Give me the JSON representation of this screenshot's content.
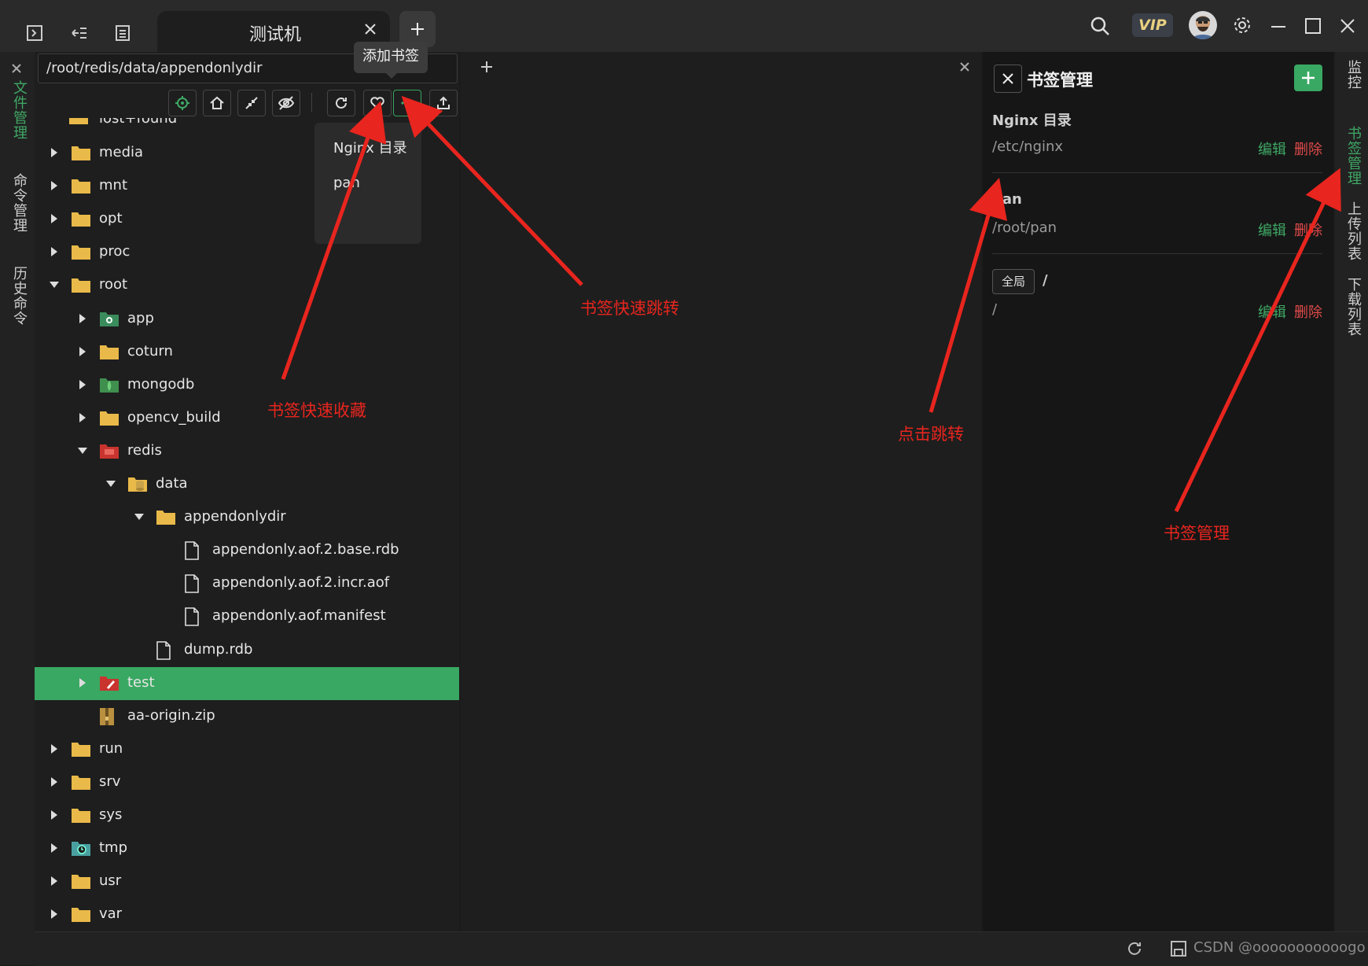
{
  "titlebar": {
    "tab_title": "测试机",
    "icons": [
      "terminal-icon",
      "tree-icon",
      "list-icon",
      "close-icon",
      "plus-icon",
      "search-icon",
      "avatar",
      "gear-icon",
      "minimize-icon",
      "maximize-icon",
      "window-close-icon"
    ],
    "vip_label": "VIP"
  },
  "left_strip": {
    "items": [
      {
        "label": "文件管理",
        "active": true
      },
      {
        "label": "命令管理",
        "active": false
      },
      {
        "label": "历史命令",
        "active": false
      }
    ]
  },
  "file_panel": {
    "path": "/root/redis/data/appendonlydir",
    "truncated_top_item": "lost+found",
    "toolbar_icons": [
      "locate-icon",
      "home-icon",
      "collapse-icon",
      "hide-icon",
      "refresh-icon",
      "heart-icon",
      "more-icon",
      "upload-icon"
    ],
    "tooltip": "添加书签",
    "dropdown": [
      "Nginx 目录",
      "pan"
    ],
    "tree": [
      {
        "name": "media",
        "kind": "folder",
        "expanded": false
      },
      {
        "name": "mnt",
        "kind": "folder",
        "expanded": false
      },
      {
        "name": "opt",
        "kind": "folder",
        "expanded": false
      },
      {
        "name": "proc",
        "kind": "folder",
        "expanded": false
      },
      {
        "name": "root",
        "kind": "folder",
        "expanded": true
      },
      {
        "name": "app",
        "kind": "app-folder",
        "expanded": false
      },
      {
        "name": "coturn",
        "kind": "folder",
        "expanded": false
      },
      {
        "name": "mongodb",
        "kind": "mongo-folder",
        "expanded": false
      },
      {
        "name": "opencv_build",
        "kind": "folder",
        "expanded": false
      },
      {
        "name": "redis",
        "kind": "redis-folder",
        "expanded": true
      },
      {
        "name": "data",
        "kind": "data-folder",
        "expanded": true
      },
      {
        "name": "appendonlydir",
        "kind": "folder",
        "expanded": true
      },
      {
        "name": "appendonly.aof.2.base.rdb",
        "kind": "file"
      },
      {
        "name": "appendonly.aof.2.incr.aof",
        "kind": "file"
      },
      {
        "name": "appendonly.aof.manifest",
        "kind": "file"
      },
      {
        "name": "dump.rdb",
        "kind": "file"
      },
      {
        "name": "test",
        "kind": "test-folder",
        "expanded": false,
        "selected": true
      },
      {
        "name": "aa-origin.zip",
        "kind": "zip"
      },
      {
        "name": "run",
        "kind": "folder",
        "expanded": false
      },
      {
        "name": "srv",
        "kind": "folder",
        "expanded": false
      },
      {
        "name": "sys",
        "kind": "folder",
        "expanded": false
      },
      {
        "name": "tmp",
        "kind": "tmp-folder",
        "expanded": false
      },
      {
        "name": "usr",
        "kind": "folder",
        "expanded": false
      },
      {
        "name": "var",
        "kind": "folder",
        "expanded": false
      }
    ]
  },
  "bookmarks": {
    "title": "书签管理",
    "edit_label": "编辑",
    "delete_label": "删除",
    "items": [
      {
        "name": "Nginx 目录",
        "path": "/etc/nginx",
        "badge": ""
      },
      {
        "name": "pan",
        "path": "/root/pan",
        "badge": ""
      },
      {
        "name": "/",
        "path": "/",
        "badge": "全局"
      }
    ]
  },
  "right_strip": {
    "items": [
      {
        "label": "监控",
        "active": false
      },
      {
        "label": "书签管理",
        "active": true
      },
      {
        "label": "上传列表",
        "active": false
      },
      {
        "label": "下载列表",
        "active": false
      }
    ]
  },
  "statusbar": {
    "watermark": "CSDN @ooooooooooogo"
  },
  "annotations": {
    "quick_collect": "书签快速收藏",
    "quick_jump": "书签快速跳转",
    "click_jump": "点击跳转",
    "bookmark_manage": "书签管理"
  },
  "colors": {
    "accent": "#39a862",
    "danger": "#e04a4a",
    "annotation": "#e8251e",
    "folder": "#e9b949"
  }
}
